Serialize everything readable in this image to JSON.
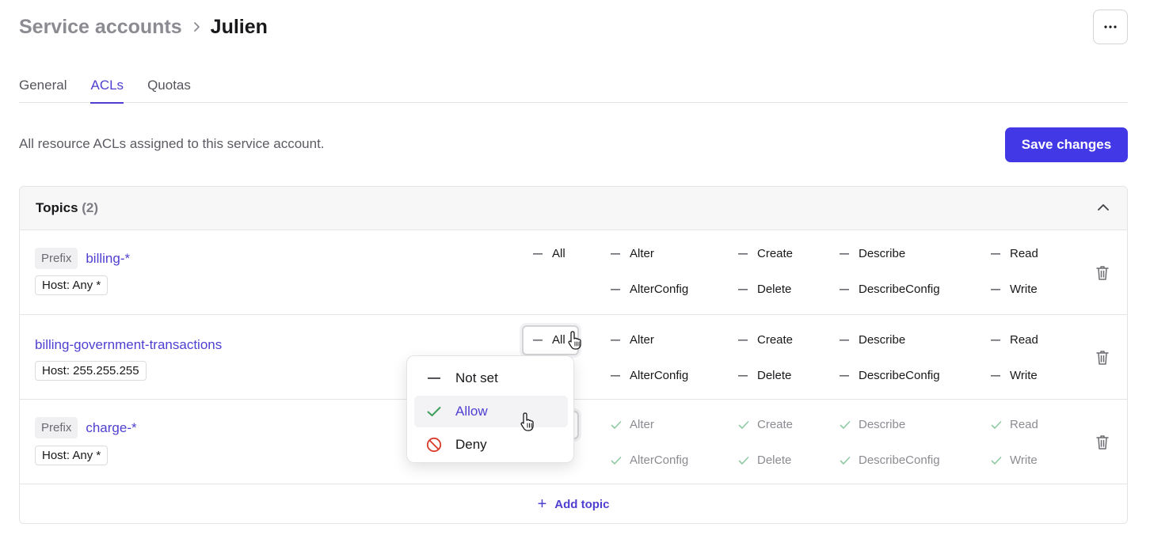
{
  "breadcrumb": {
    "parent": "Service accounts",
    "current": "Julien"
  },
  "header": {
    "more_label": "···"
  },
  "tabs": [
    {
      "label": "General",
      "active": false
    },
    {
      "label": "ACLs",
      "active": true
    },
    {
      "label": "Quotas",
      "active": false
    }
  ],
  "description": "All resource ACLs assigned to this service account.",
  "save_label": "Save changes",
  "topics_section": {
    "title": "Topics",
    "count": "(2)",
    "expanded": true
  },
  "permission_names": {
    "all": "All",
    "alter": "Alter",
    "alterconfig": "AlterConfig",
    "create": "Create",
    "delete": "Delete",
    "describe": "Describe",
    "describeconfig": "DescribeConfig",
    "read": "Read",
    "write": "Write"
  },
  "rows": [
    {
      "prefix_label": "Prefix",
      "name": "billing-*",
      "host": "Host: Any *",
      "state": "not-set"
    },
    {
      "prefix_label": "",
      "name": "billing-government-transactions",
      "host": "Host: 255.255.255",
      "state": "not-set"
    },
    {
      "prefix_label": "Prefix",
      "name": "charge-*",
      "host": "Host: Any *",
      "state": "allow"
    }
  ],
  "add_topic_label": "Add topic",
  "dropdown": {
    "options": [
      {
        "label": "Not set",
        "icon": "dash-icon"
      },
      {
        "label": "Allow",
        "icon": "check-icon",
        "selected": true
      },
      {
        "label": "Deny",
        "icon": "deny-icon"
      }
    ]
  },
  "colors": {
    "accent": "#4f3fd1",
    "primary_button": "#4338e5",
    "allow_check": "#3f9e5c",
    "deny": "#d93b2b"
  }
}
